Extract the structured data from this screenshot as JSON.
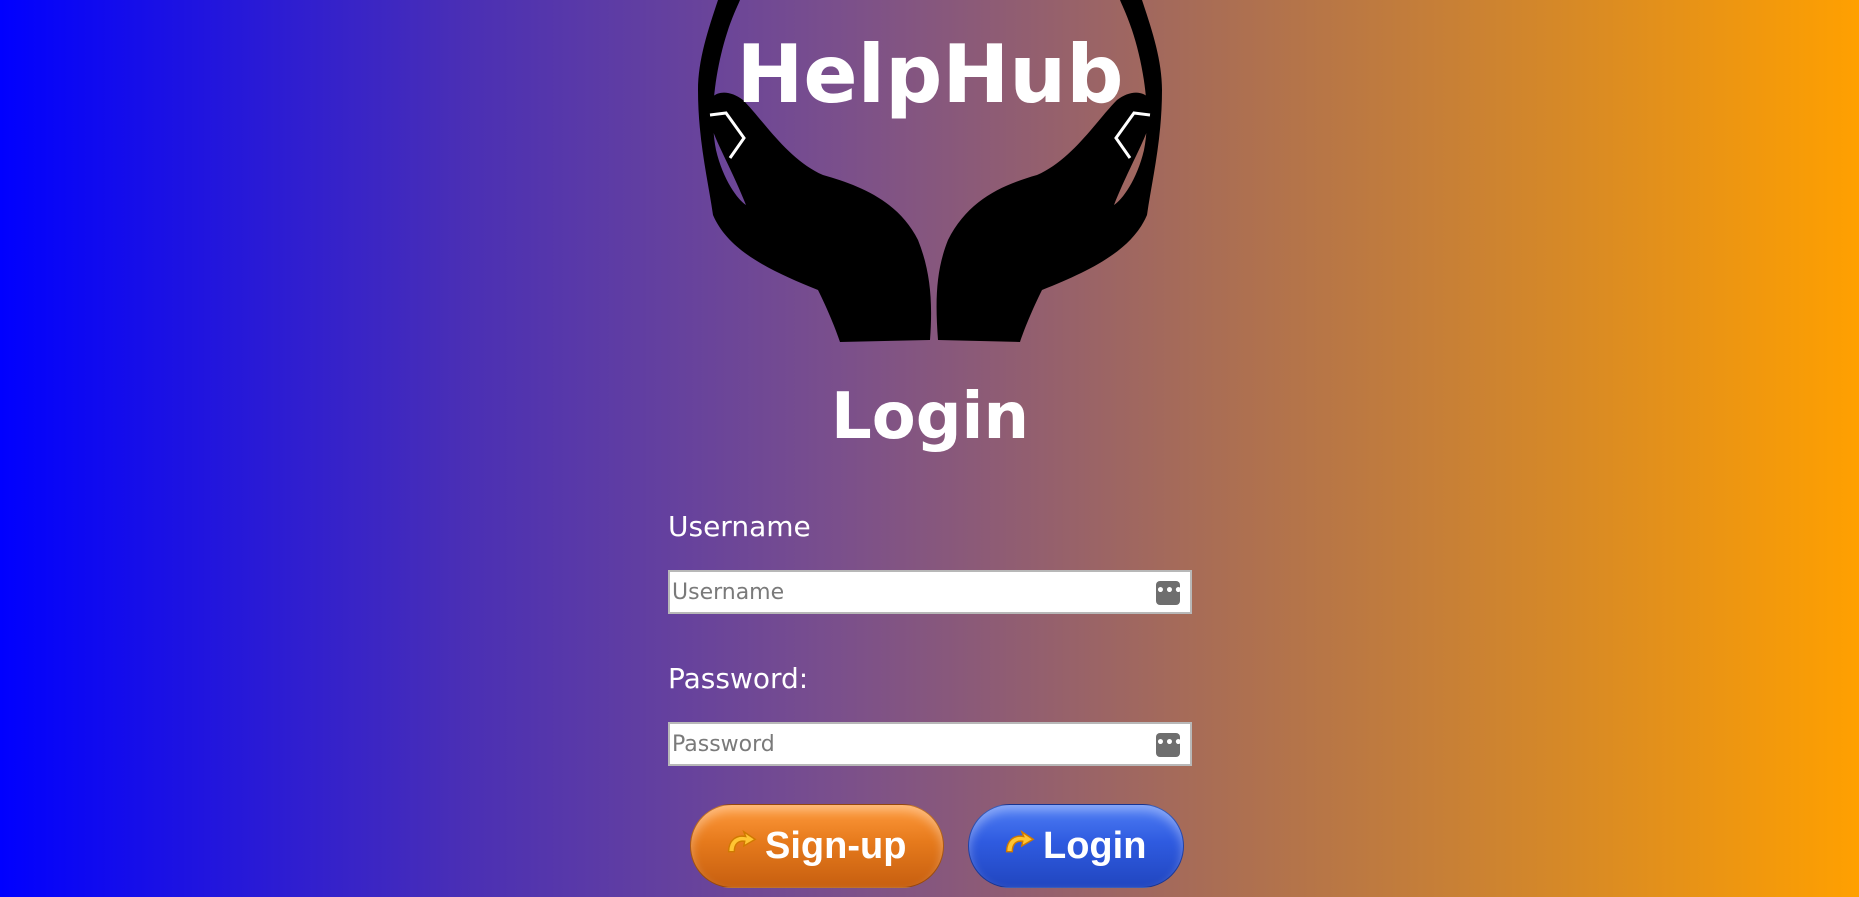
{
  "app": {
    "title": "HelpHub"
  },
  "page": {
    "heading": "Login"
  },
  "form": {
    "username_label": "Username",
    "username_placeholder": "Username",
    "username_value": "",
    "password_label": "Password:",
    "password_placeholder": "Password",
    "password_value": ""
  },
  "buttons": {
    "signup_label": "Sign-up",
    "login_label": "Login"
  },
  "colors": {
    "gradient_start": "#0000ff",
    "gradient_end": "#ffa000",
    "signup_button": "#e67a1c",
    "login_button": "#2f5be0",
    "logo_hands": "#000000"
  },
  "icons": {
    "logo": "cupped-hands-icon",
    "field_icon": "password-manager-icon",
    "button_icon": "curved-arrow-icon"
  }
}
